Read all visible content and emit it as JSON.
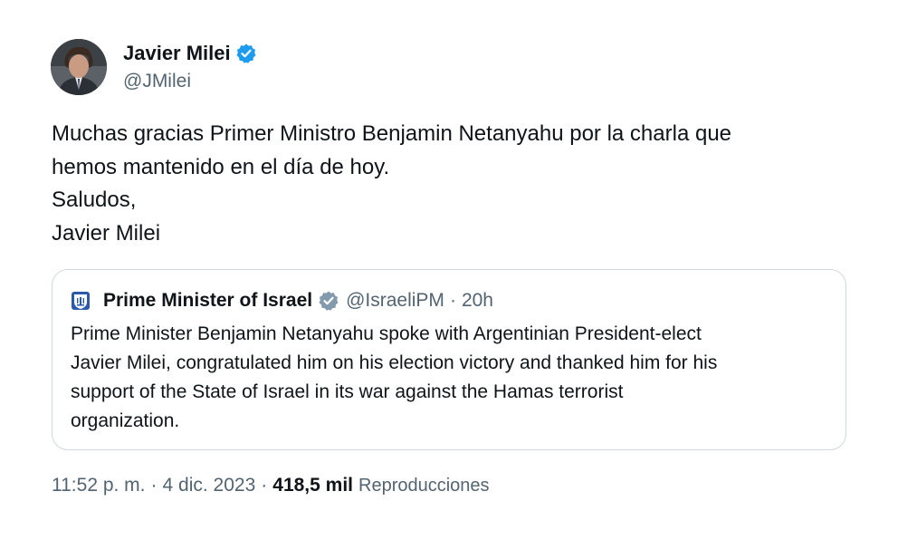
{
  "author": {
    "name": "Javier Milei",
    "handle": "@JMilei",
    "avatar_icon": "profile-photo"
  },
  "tweet": {
    "lines": [
      "Muchas gracias Primer Ministro Benjamin Netanyahu por la charla que",
      "hemos mantenido en el día de hoy.",
      "Saludos,",
      "Javier Milei"
    ]
  },
  "quoted_tweet": {
    "name": "Prime Minister of Israel",
    "handle": "@IsraeliPM",
    "separator": "·",
    "time": "20h",
    "avatar_icon": "israel-emblem-icon",
    "verified_color": "#829aab",
    "lines": [
      "Prime Minister Benjamin Netanyahu spoke with Argentinian President-elect",
      "Javier Milei, congratulated him on his election victory and thanked him for his",
      "support of the State of Israel in its war against the Hamas terrorist",
      "organization."
    ]
  },
  "meta": {
    "time": "11:52 p. m.",
    "separator": "·",
    "date": "4 dic. 2023",
    "views_count": "418,5 mil",
    "views_label": "Reproducciones"
  },
  "colors": {
    "verified_blue": "#1d9bf0",
    "text_primary": "#0f1419",
    "text_secondary": "#536471",
    "border": "#cfd9de"
  }
}
